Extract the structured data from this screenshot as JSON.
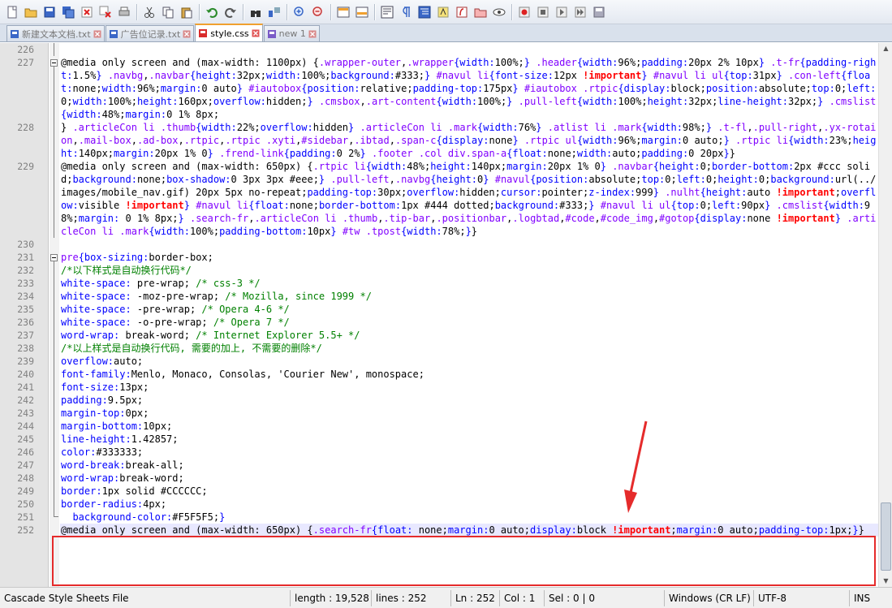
{
  "toolbar": {
    "buttons": [
      "new-icon",
      "open-icon",
      "save-icon",
      "save-all-icon",
      "close-icon",
      "close-all-icon",
      "print-icon",
      "|",
      "cut-icon",
      "copy-icon",
      "paste-icon",
      "|",
      "undo-icon",
      "redo-icon",
      "|",
      "find-icon",
      "replace-icon",
      "|",
      "zoom-in-icon",
      "zoom-out-icon",
      "|",
      "sync-vertical-icon",
      "sync-horizontal-icon",
      "|",
      "word-wrap-icon",
      "show-all-chars-icon",
      "indent-guide-icon",
      "user-language-icon",
      "function-list-icon",
      "folder-workspace-icon",
      "monitor-icon",
      "|",
      "record-macro-icon",
      "stop-macro-icon",
      "play-macro-icon",
      "run-macro-multiple-icon",
      "save-macro-icon"
    ]
  },
  "tabs": [
    {
      "label": "新建文本文档.txt",
      "icon": "txt-file-icon",
      "color": "#3a67c7",
      "active": false
    },
    {
      "label": "广告位记录.txt",
      "icon": "txt-file-icon",
      "color": "#3a67c7",
      "active": false
    },
    {
      "label": "style.css",
      "icon": "css-file-icon",
      "color": "#d92b2b",
      "active": true
    },
    {
      "label": "new 1",
      "icon": "new-file-icon",
      "color": "#7a5bc7",
      "active": false
    }
  ],
  "editor": {
    "lines": [
      {
        "n": "226",
        "fold": "bar",
        "t": ""
      },
      {
        "n": "227",
        "fold": "open",
        "t": "@media only screen and (max-width: 1100px) {<s>.wrapper-outer</s>,<s>.wrapper</s><p>{width:</p>100%;<p>}</p> <s>.header</s><p>{width:</p>96%;<p>padding:</p>20px 2% 10px<p>}</p> <s>.t-fr</s><p>{padding-right:</p>1.5%<p>}</p> <s>.navbg</s>,<s>.navbar</s><p>{height:</p>32px;<p>width:</p>100%;<p>background:</p>#333;<p>}</p> <s>#navul li</s><p>{font-size:</p>12px <i>!important</i><p>}</p> <s>#navul li ul</s><p>{top:</p>31px<p>}</p> <s>.con-left</s><p>{float:</p>none;<p>width:</p>96%;<p>margin:</p>0 auto<p>}</p> <s>#iautobox</s><p>{position:</p>relative;<p>padding-top:</p>175px<p>}</p> <s>#iautobox .rtpic</s><p>{display:</p>block;<p>position:</p>absolute;<p>top:</p>0;<p>left:</p>0;<p>width:</p>100%;<p>height:</p>160px;<p>overflow:</p>hidden;<p>}</p> <s>.cmsbox</s>,<s>.art-content</s><p>{width:</p>100%;<p>}</p> <s>.pull-left</s><p>{width:</p>100%;<p>height:</p>32px;<p>line-height:</p>32px;<p>}</p> <s>.cmslist</s><p>{width:</p>48%;<p>margin:</p>0 1% 8px;"
      },
      {
        "n": "228",
        "fold": "bar",
        "t": "} <s>.articleCon li .thumb</s><p>{width:</p>22%;<p>overflow:</p>hidden<p>}</p> <s>.articleCon li .mark</s><p>{width:</p>76%<p>}</p> <s>.atlist li .mark</s><p>{width:</p>98%;<p>}</p> <s>.t-fl</s>,<s>.pull-right</s>,<s>.yx-rotaion</s>,<s>.mail-box</s>,<s>.ad-box</s>,<s>.rtpic</s>,<s>.rtpic .xyti</s>,<s>#sidebar</s>,<s>.ibtad</s>,<s>.span-c</s><p>{display:</p>none<p>}</p> <s>.rtpic ul</s><p>{width:</p>96%;<p>margin:</p>0 auto;<p>}</p> <s>.rtpic li</s><p>{width:</p>23%;<p>height:</p>140px;<p>margin:</p>20px 1% 0<p>}</p> <s>.frend-link</s><p>{padding:</p>0 2%<p>}</p> <s>.footer .col div.span-a</s><p>{float:</p>none;<p>width:</p>auto;<p>padding:</p>0 20px<p>}</p>}"
      },
      {
        "n": "229",
        "fold": "bar",
        "t": "@media only screen and (max-width: 650px) {<s>.rtpic li</s><p>{width:</p>48%;<p>height:</p>140px;<p>margin:</p>20px 1% 0<p>}</p> <s>.navbar</s><p>{height:</p>0;<p>border-bottom:</p>2px #ccc solid;<p>background:</p>none;<p>box-shadow:</p>0 3px 3px #eee;<p>}</p> <s>.pull-left</s>,<s>.navbg</s><p>{height:</p>0<p>}</p> <s>#navul</s><p>{position:</p>absolute;<p>top:</p>0;<p>left:</p>0;<p>height:</p>0;<p>background:</p>url(../images/mobile_nav.gif) 20px 5px no-repeat;<p>padding-top:</p>30px;<p>overflow:</p>hidden;<p>cursor:</p>pointer;<p>z-index:</p>999<p>}</p> <s>.nulht</s><p>{height:</p>auto <i>!important</i>;<p>overflow:</p>visible <i>!important</i><p>}</p> <s>#navul li</s><p>{float:</p>none;<p>border-bottom:</p>1px #444 dotted;<p>background:</p>#333;<p>}</p> <s>#navul li ul</s><p>{top:</p>0;<p>left:</p>90px<p>}</p> <s>.cmslist</s><p>{width:</p>98%;<p>margin:</p> 0 1% 8px;<p>}</p> <s>.search-fr</s>,<s>.articleCon li .thumb</s>,<s>.tip-bar</s>,<s>.positionbar</s>,<s>.logbtad</s>,<s>#code</s>,<s>#code_img</s>,<s>#gotop</s><p>{display:</p>none <i>!important</i><p>}</p> <s>.articleCon li .mark</s><p>{width:</p>100%;<p>padding-bottom:</p>10px<p>}</p> <s>#tw .tpost</s><p>{width:</p>78%;<p>}</p>}"
      },
      {
        "n": "230",
        "fold": "",
        "t": ""
      },
      {
        "n": "231",
        "fold": "open",
        "t": "<s>pre</s><p>{box-sizing:</p>border-box;"
      },
      {
        "n": "232",
        "fold": "bar",
        "t": "<c>/*以下样式是自动换行代码*/</c>"
      },
      {
        "n": "233",
        "fold": "bar",
        "t": "<p>white-space:</p> pre-wrap; <c>/* css-3 */</c>"
      },
      {
        "n": "234",
        "fold": "bar",
        "t": "<p>white-space:</p> -moz-pre-wrap; <c>/* Mozilla, since 1999 */</c>"
      },
      {
        "n": "235",
        "fold": "bar",
        "t": "<p>white-space:</p> -pre-wrap; <c>/* Opera 4-6 */</c>"
      },
      {
        "n": "236",
        "fold": "bar",
        "t": "<p>white-space:</p> -o-pre-wrap; <c>/* Opera 7 */</c>"
      },
      {
        "n": "237",
        "fold": "bar",
        "t": "<p>word-wrap:</p> break-word; <c>/* Internet Explorer 5.5+ */</c>"
      },
      {
        "n": "238",
        "fold": "bar",
        "t": "<c>/*以上样式是自动换行代码, 需要的加上, 不需要的删除*/</c>"
      },
      {
        "n": "239",
        "fold": "bar",
        "t": "<p>overflow:</p>auto;"
      },
      {
        "n": "240",
        "fold": "bar",
        "t": "<p>font-family:</p>Menlo, Monaco, Consolas, 'Courier New', monospace;"
      },
      {
        "n": "241",
        "fold": "bar",
        "t": "<p>font-size:</p>13px;"
      },
      {
        "n": "242",
        "fold": "bar",
        "t": "<p>padding:</p>9.5px;"
      },
      {
        "n": "243",
        "fold": "bar",
        "t": "<p>margin-top:</p>0px;"
      },
      {
        "n": "244",
        "fold": "bar",
        "t": "<p>margin-bottom:</p>10px;"
      },
      {
        "n": "245",
        "fold": "bar",
        "t": "<p>line-height:</p>1.42857;"
      },
      {
        "n": "246",
        "fold": "bar",
        "t": "<p>color:</p>#333333;"
      },
      {
        "n": "247",
        "fold": "bar",
        "t": "<p>word-break:</p>break-all;"
      },
      {
        "n": "248",
        "fold": "bar",
        "t": "<p>word-wrap:</p>break-word;"
      },
      {
        "n": "249",
        "fold": "bar",
        "t": "<p>border:</p>1px solid #CCCCCC;"
      },
      {
        "n": "250",
        "fold": "bar",
        "t": "<p>border-radius:</p>4px;"
      },
      {
        "n": "251",
        "fold": "end",
        "t": "  <p>background-color:</p>#F5F5F5;<p>}</p>"
      },
      {
        "n": "252",
        "fold": "",
        "hl": true,
        "t": "@media only screen and (max-width: 650px) {<s>.search-fr</s><p>{float:</p> none;<p>margin:</p>0 auto;<p>display:</p>block <i>!important</i>;<p>margin:</p>0 auto;<p>padding-top:</p>1px;<p>}</p>}"
      }
    ]
  },
  "annotation": {
    "box_color": "#e52b2b"
  },
  "status": {
    "lang": "Cascade Style Sheets File",
    "length": "length : 19,528",
    "lines": "lines : 252",
    "ln": "Ln : 252",
    "col": "Col : 1",
    "sel": "Sel : 0 | 0",
    "eol": "Windows (CR LF)",
    "enc": "UTF-8",
    "mode": "INS"
  }
}
